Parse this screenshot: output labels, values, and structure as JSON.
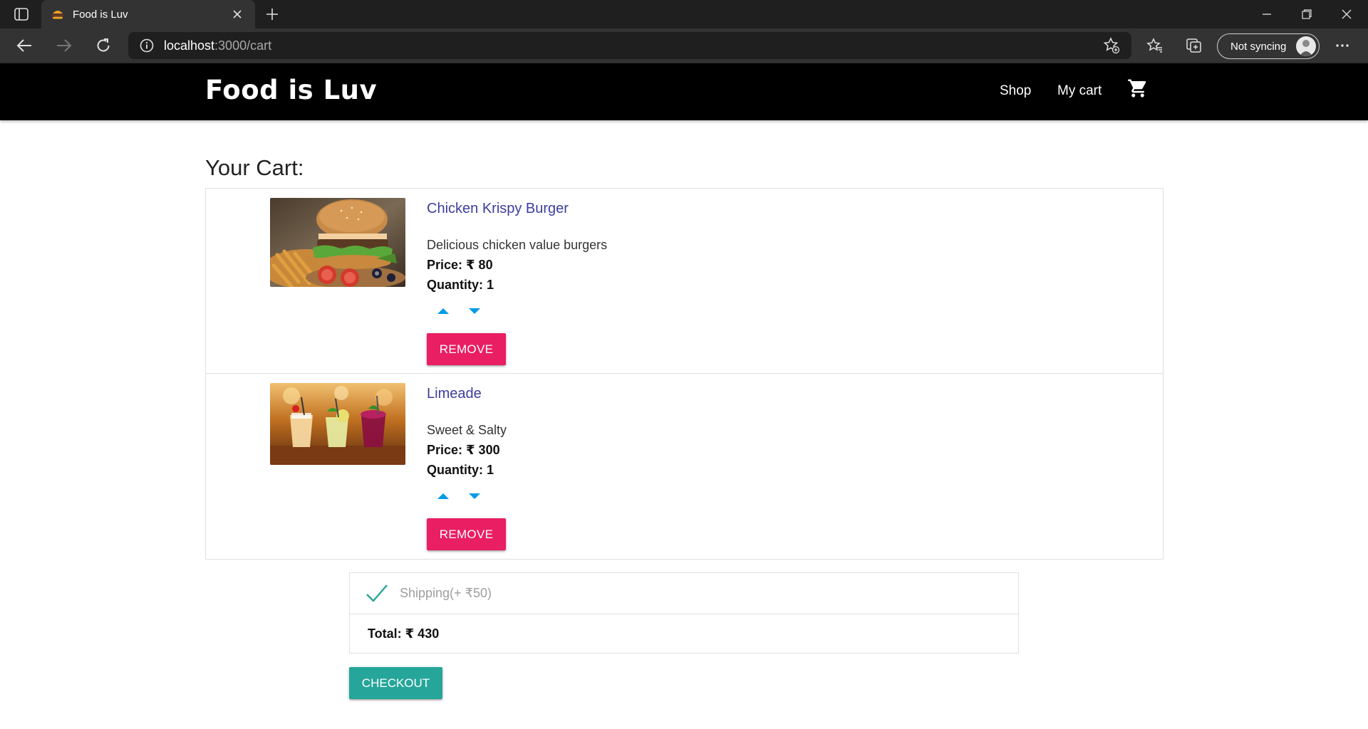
{
  "browser": {
    "tab_title": "Food is Luv",
    "address_host": "localhost",
    "address_path": ":3000/cart",
    "profile_label": "Not syncing"
  },
  "site": {
    "brand": "Food is Luv",
    "nav": {
      "shop": "Shop",
      "my_cart": "My cart"
    }
  },
  "page_title": "Your Cart:",
  "items": [
    {
      "title": "Chicken Krispy Burger",
      "description": "Delicious chicken value burgers",
      "price": "Price: ₹ 80",
      "quantity": "Quantity: 1",
      "remove_label": "REMOVE"
    },
    {
      "title": "Limeade",
      "description": "Sweet & Salty",
      "price": "Price: ₹ 300",
      "quantity": "Quantity: 1",
      "remove_label": "REMOVE"
    }
  ],
  "summary": {
    "shipping_label": "Shipping(+ ₹50)",
    "total": "Total: ₹ 430"
  },
  "checkout_label": "CHECKOUT",
  "colors": {
    "accent_remove": "#e91e63",
    "accent_checkout": "#26a69a",
    "qty_arrow": "#039be5",
    "item_title": "#3d3d9e"
  }
}
